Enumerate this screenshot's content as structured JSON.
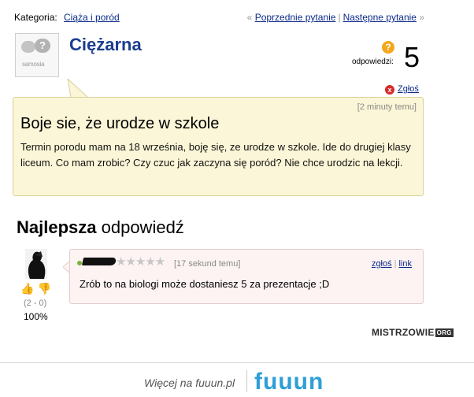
{
  "topbar": {
    "category_label": "Kategoria:",
    "category_link": "Ciąża i poród",
    "prev_arrow": "«",
    "prev_link": "Poprzednie pytanie",
    "separator": "|",
    "next_link": "Następne pytanie",
    "next_arrow": "»"
  },
  "question": {
    "avatar_logo": "samosia",
    "author": "Ciężarna",
    "answers_icon": "?",
    "answers_label": "odpowiedzi:",
    "answers_count": "5",
    "report_icon": "x",
    "report_label": "Zgłoś",
    "time": "[2 minuty temu]",
    "title": "Boje sie, że urodze w szkole",
    "body": "Termin porodu mam na 18 września, boję się, ze urodze w szkole. Ide do drugiej klasy liceum. Co mam zrobic? Czy czuc jak zaczyna się poród? Nie chce urodzic na lekcji."
  },
  "best_answer": {
    "heading_bold": "Najlepsza",
    "heading_rest": " odpowiedź",
    "thumb_up_icon": "👍",
    "thumb_down_icon": "👎",
    "votes": "(2 - 0)",
    "percent": "100%",
    "stars_text": "★★★★★",
    "rating": 0,
    "time": "[17 sekund temu]",
    "report_link": "zgłoś",
    "separator": "|",
    "link_label": "link",
    "text": "Zrób to na biologi może dostaniesz 5 za prezentacje ;D"
  },
  "watermark": {
    "brand": "MISTRZOWIE",
    "tld": "ORG"
  },
  "footer": {
    "more_text": "Więcej na fuuun.pl",
    "logo": "fuuun"
  },
  "colors": {
    "link": "#0b2a8a",
    "author": "#1b3d8f",
    "question_bg": "#fbf6d7",
    "answer_bg": "#fdf3f3",
    "fuuun_logo": "#2f9fd6"
  }
}
